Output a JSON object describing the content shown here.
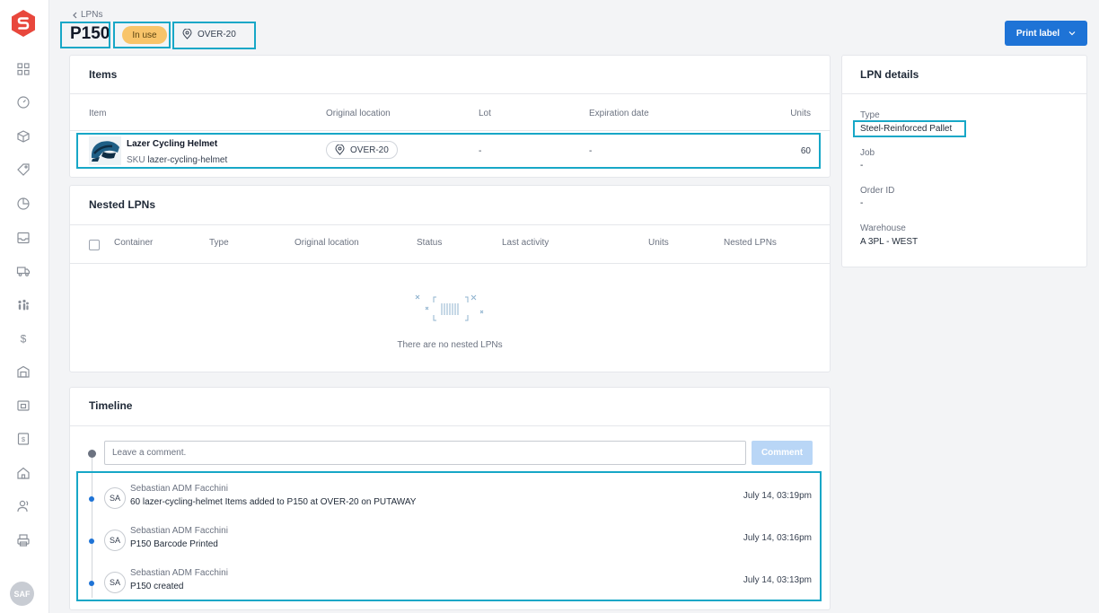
{
  "sidebar": {
    "icons": [
      "grid-icon",
      "dashboard-gauge-icon",
      "box-icon",
      "tag-icon",
      "chart-pie-icon",
      "inbox-icon",
      "truck-icon",
      "people-icon",
      "dollar-icon",
      "warehouse-icon",
      "package-icon",
      "invoice-icon",
      "home-icon",
      "user-icon",
      "printer-icon"
    ],
    "avatar_initials": "SAF"
  },
  "header": {
    "breadcrumb": "LPNs",
    "title": "P150",
    "status": "In use",
    "location": "OVER-20",
    "print_label": "Print label"
  },
  "items_card": {
    "title": "Items",
    "columns": [
      "Item",
      "Original location",
      "Lot",
      "Expiration date",
      "Units"
    ],
    "rows": [
      {
        "name": "Lazer Cycling Helmet",
        "sku_label": "SKU",
        "sku": "lazer-cycling-helmet",
        "location": "OVER-20",
        "lot": "-",
        "expiration": "-",
        "units": "60"
      }
    ]
  },
  "nested_card": {
    "title": "Nested LPNs",
    "columns": [
      "Container",
      "Type",
      "Original location",
      "Status",
      "Last activity",
      "Units",
      "Nested LPNs"
    ],
    "empty_text": "There are no nested LPNs"
  },
  "timeline": {
    "title": "Timeline",
    "comment_placeholder": "Leave a comment.",
    "comment_button": "Comment",
    "entries": [
      {
        "initials": "SA",
        "user": "Sebastian ADM Facchini",
        "text": "60 lazer-cycling-helmet Items added to P150 at OVER-20 on PUTAWAY",
        "time": "July 14, 03:19pm"
      },
      {
        "initials": "SA",
        "user": "Sebastian ADM Facchini",
        "text": "P150 Barcode Printed",
        "time": "July 14, 03:16pm"
      },
      {
        "initials": "SA",
        "user": "Sebastian ADM Facchini",
        "text": "P150 created",
        "time": "July 14, 03:13pm"
      }
    ]
  },
  "details": {
    "title": "LPN details",
    "fields": [
      {
        "label": "Type",
        "value": "Steel-Reinforced Pallet"
      },
      {
        "label": "Job",
        "value": "-"
      },
      {
        "label": "Order ID",
        "value": "-"
      },
      {
        "label": "Warehouse",
        "value": "A 3PL - WEST"
      }
    ]
  },
  "colors": {
    "accent": "#1e73d6",
    "highlight": "#17a7c7",
    "status_pill": "#f8c46a",
    "brand": "#e8473c"
  }
}
